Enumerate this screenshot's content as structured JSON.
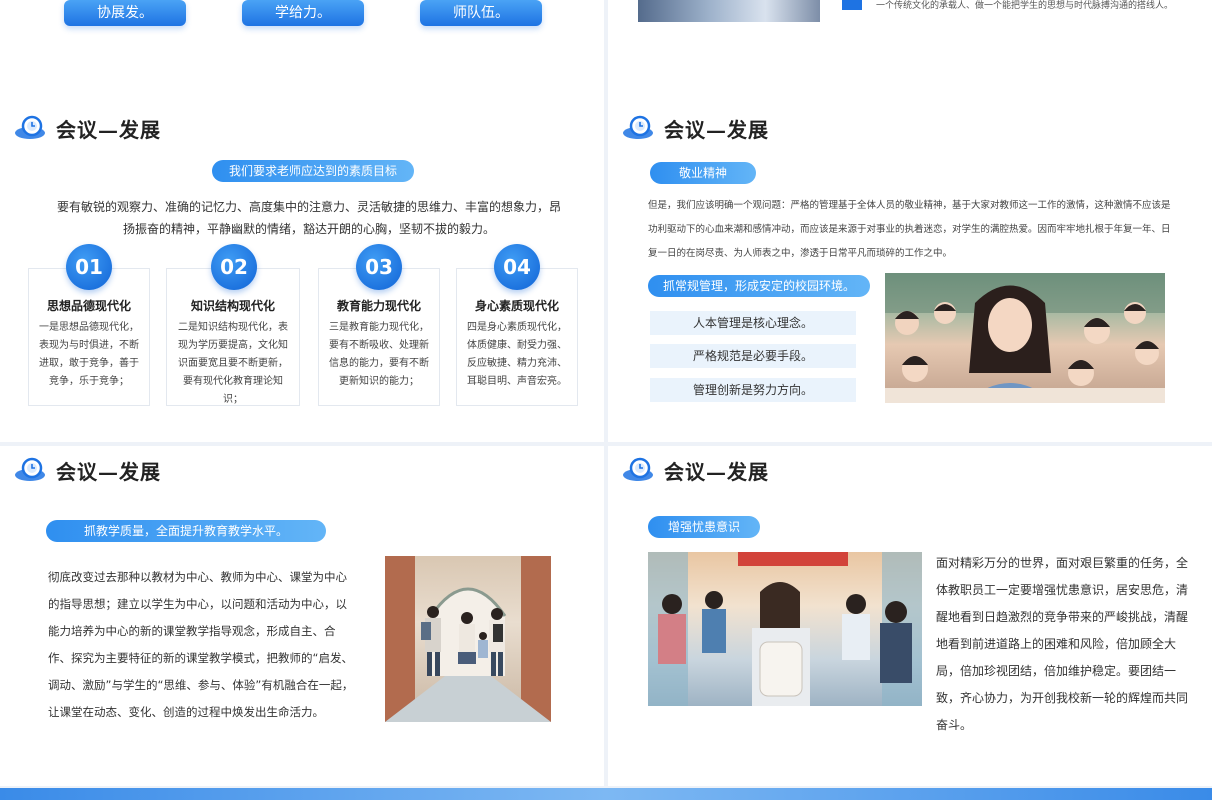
{
  "top_left": {
    "buttons": [
      "协展发。",
      "学给力。",
      "师队伍。"
    ]
  },
  "top_right": {
    "text": "一个传统文化的承载人、做一个能把学生的思想与时代脉搏沟通的搭线人。"
  },
  "header_title": "会议—发展",
  "slide_a": {
    "title": "会议—发展",
    "pill": "我们要求老师应达到的素质目标",
    "intro": "要有敏锐的观察力、准确的记忆力、高度集中的注意力、灵活敏捷的思维力、丰富的想象力，昂扬振奋的精神，平静幽默的情绪，豁达开朗的心胸，坚韧不拔的毅力。",
    "cards": [
      {
        "num": "01",
        "title": "思想品德现代化",
        "body": "一是思想品德现代化，表现为与时俱进，不断进取，敢于竞争，善于竞争，乐于竞争；"
      },
      {
        "num": "02",
        "title": "知识结构现代化",
        "body": "二是知识结构现代化，表现为学历要提高，文化知识面要宽且要不断更新，要有现代化教育理论知识；"
      },
      {
        "num": "03",
        "title": "教育能力现代化",
        "body": "三是教育能力现代化，要有不断吸收、处理新信息的能力，要有不断更新知识的能力；"
      },
      {
        "num": "04",
        "title": "身心素质现代化",
        "body": "四是身心素质现代化，体质健康、耐受力强、反应敏捷、精力充沛、耳聪目明、声音宏亮。"
      }
    ]
  },
  "slide_b": {
    "title": "会议—发展",
    "pill1": "敬业精神",
    "para": "但是，我们应该明确一个观问题：严格的管理基于全体人员的敬业精神，基于大家对教师这一工作的激情，这种激情不应该是功利驱动下的心血来潮和感情冲动，而应该是来源于对事业的执着迷恋，对学生的满腔热爱。因而牢牢地扎根于年复一年、日复一日的在岗尽责、为人师表之中，渗透于日常平凡而琐碎的工作之中。",
    "pill2": "抓常规管理，形成安定的校园环境。",
    "items": [
      "人本管理是核心理念。",
      "严格规范是必要手段。",
      "管理创新是努力方向。"
    ]
  },
  "slide_c": {
    "title": "会议—发展",
    "pill": "抓教学质量，全面提升教育教学水平。",
    "para": "彻底改变过去那种以教材为中心、教师为中心、课堂为中心的指导思想；建立以学生为中心，以问题和活动为中心，以能力培养为中心的新的课堂教学指导观念，形成自主、合作、探究为主要特征的新的课堂教学模式，把教师的“启发、调动、激励”与学生的“思维、参与、体验”有机融合在一起，让课堂在动态、变化、创造的过程中焕发出生命活力。"
  },
  "slide_d": {
    "title": "会议—发展",
    "pill": "增强忧患意识",
    "para": "面对精彩万分的世界，面对艰巨繁重的任务，全体教职员工一定要增强忧患意识，居安思危，清醒地看到日趋激烈的竞争带来的严峻挑战，清醒地看到前进道路上的困难和风险，倍加顾全大局，倍加珍视团结，倍加维护稳定。要团结一致，齐心协力，为开创我校新一轮的辉煌而共同奋斗。"
  },
  "colors": {
    "accent": "#1e73e3",
    "accent_light": "#63b5f7",
    "item_bg": "#eaf3fc"
  }
}
